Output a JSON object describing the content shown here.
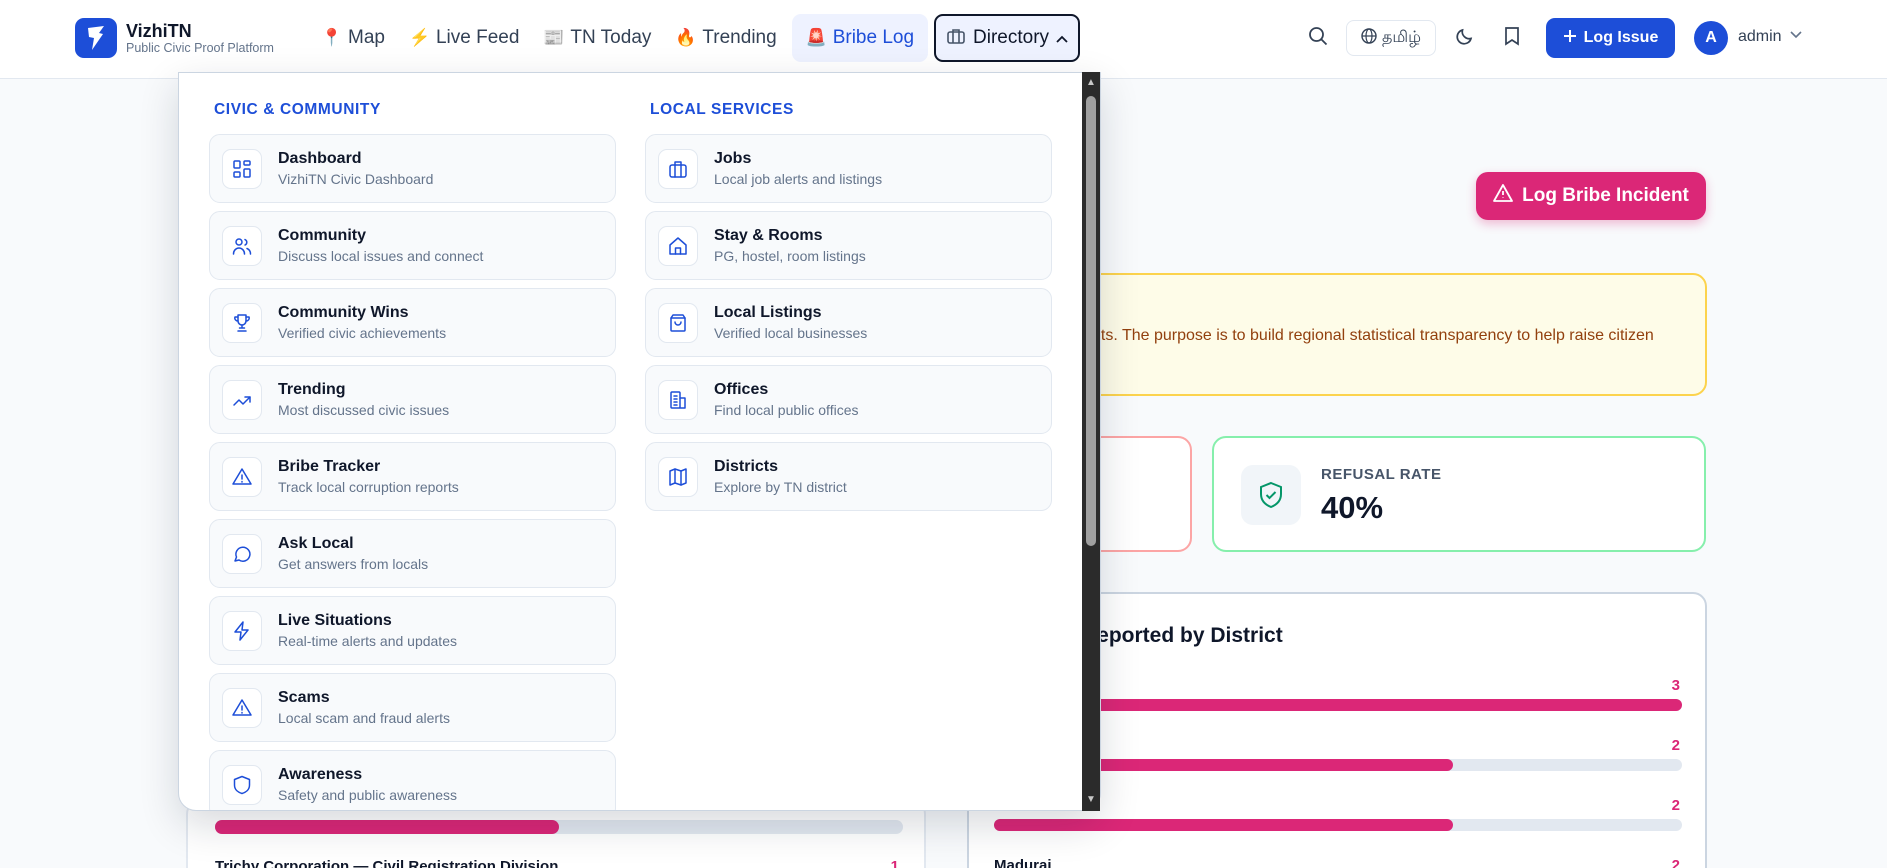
{
  "brand": {
    "name": "VizhiTN",
    "tagline": "Public Civic Proof Platform"
  },
  "nav": {
    "items": [
      {
        "label": "Map",
        "icon": "map-pin-icon"
      },
      {
        "label": "Live Feed",
        "icon": "lightning-icon"
      },
      {
        "label": "TN Today",
        "icon": "newspaper-icon"
      },
      {
        "label": "Trending",
        "icon": "fire-icon"
      },
      {
        "label": "Bribe Log",
        "icon": "siren-icon"
      },
      {
        "label": "Directory",
        "icon": "briefcase-icon"
      }
    ]
  },
  "header": {
    "language": "தமிழ்",
    "log_issue": "Log Issue",
    "user_initial": "A",
    "user_name": "admin"
  },
  "page": {
    "log_bribe_button": "Log Bribe Incident",
    "notice_text": "nts. The purpose is to build regional statistical transparency to help raise citizen",
    "refusal_label": "REFUSAL RATE",
    "refusal_value": "40%",
    "district_title": "reported by District",
    "district_bars": [
      {
        "name": "",
        "count": "3",
        "fraction": 1.0
      },
      {
        "name": "",
        "count": "2",
        "fraction": 0.667
      },
      {
        "name": "",
        "count": "2",
        "fraction": 0.667
      },
      {
        "name": "Madurai",
        "count": "2",
        "fraction": 0.667
      }
    ],
    "left_bar": {
      "name": "Trichy Corporation — Civil Registration Division",
      "count": "1",
      "fraction": 0.5
    }
  },
  "directory": {
    "civic": {
      "title": "CIVIC & COMMUNITY",
      "items": [
        {
          "label": "Dashboard",
          "desc": "VizhiTN Civic Dashboard",
          "icon": "dashboard-icon"
        },
        {
          "label": "Community",
          "desc": "Discuss local issues and connect",
          "icon": "users-icon"
        },
        {
          "label": "Community Wins",
          "desc": "Verified civic achievements",
          "icon": "trophy-icon"
        },
        {
          "label": "Trending",
          "desc": "Most discussed civic issues",
          "icon": "trending-up-icon"
        },
        {
          "label": "Bribe Tracker",
          "desc": "Track local corruption reports",
          "icon": "warning-icon"
        },
        {
          "label": "Ask Local",
          "desc": "Get answers from locals",
          "icon": "chat-icon"
        },
        {
          "label": "Live Situations",
          "desc": "Real-time alerts and updates",
          "icon": "lightning-icon"
        },
        {
          "label": "Scams",
          "desc": "Local scam and fraud alerts",
          "icon": "warning-icon"
        },
        {
          "label": "Awareness",
          "desc": "Safety and public awareness",
          "icon": "shield-icon"
        }
      ]
    },
    "local": {
      "title": "LOCAL SERVICES",
      "items": [
        {
          "label": "Jobs",
          "desc": "Local job alerts and listings",
          "icon": "briefcase-icon"
        },
        {
          "label": "Stay & Rooms",
          "desc": "PG, hostel, room listings",
          "icon": "home-icon"
        },
        {
          "label": "Local Listings",
          "desc": "Verified local businesses",
          "icon": "shopping-bag-icon"
        },
        {
          "label": "Offices",
          "desc": "Find local public offices",
          "icon": "building-icon"
        },
        {
          "label": "Districts",
          "desc": "Explore by TN district",
          "icon": "map-icon"
        }
      ]
    }
  },
  "colors": {
    "primary": "#1d4ed8",
    "accent": "#db2777",
    "warning_bg": "#fefce8",
    "success": "#86efac"
  }
}
